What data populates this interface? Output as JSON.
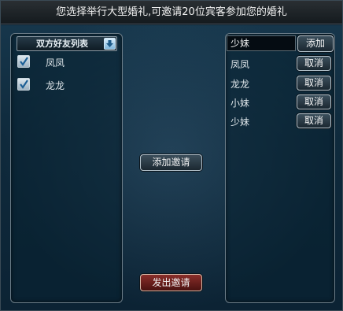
{
  "window": {
    "title": "您选择举行大型婚礼,可邀请20位宾客参加您的婚礼"
  },
  "friend_list": {
    "header": "双方好友列表",
    "items": [
      {
        "name": "凤凤",
        "checked": true
      },
      {
        "name": "龙龙",
        "checked": true
      }
    ]
  },
  "guest_panel": {
    "input_value": "少妹",
    "add_label": "添加",
    "guests": [
      {
        "name": "凤凤",
        "cancel_label": "取消"
      },
      {
        "name": "龙龙",
        "cancel_label": "取消"
      },
      {
        "name": "小妹",
        "cancel_label": "取消"
      },
      {
        "name": "少妹",
        "cancel_label": "取消"
      }
    ]
  },
  "actions": {
    "add_invite_label": "添加邀请",
    "send_invite_label": "发出邀请"
  },
  "colors": {
    "background": "#0f2a3c",
    "send_button": "#8a2e2a"
  }
}
